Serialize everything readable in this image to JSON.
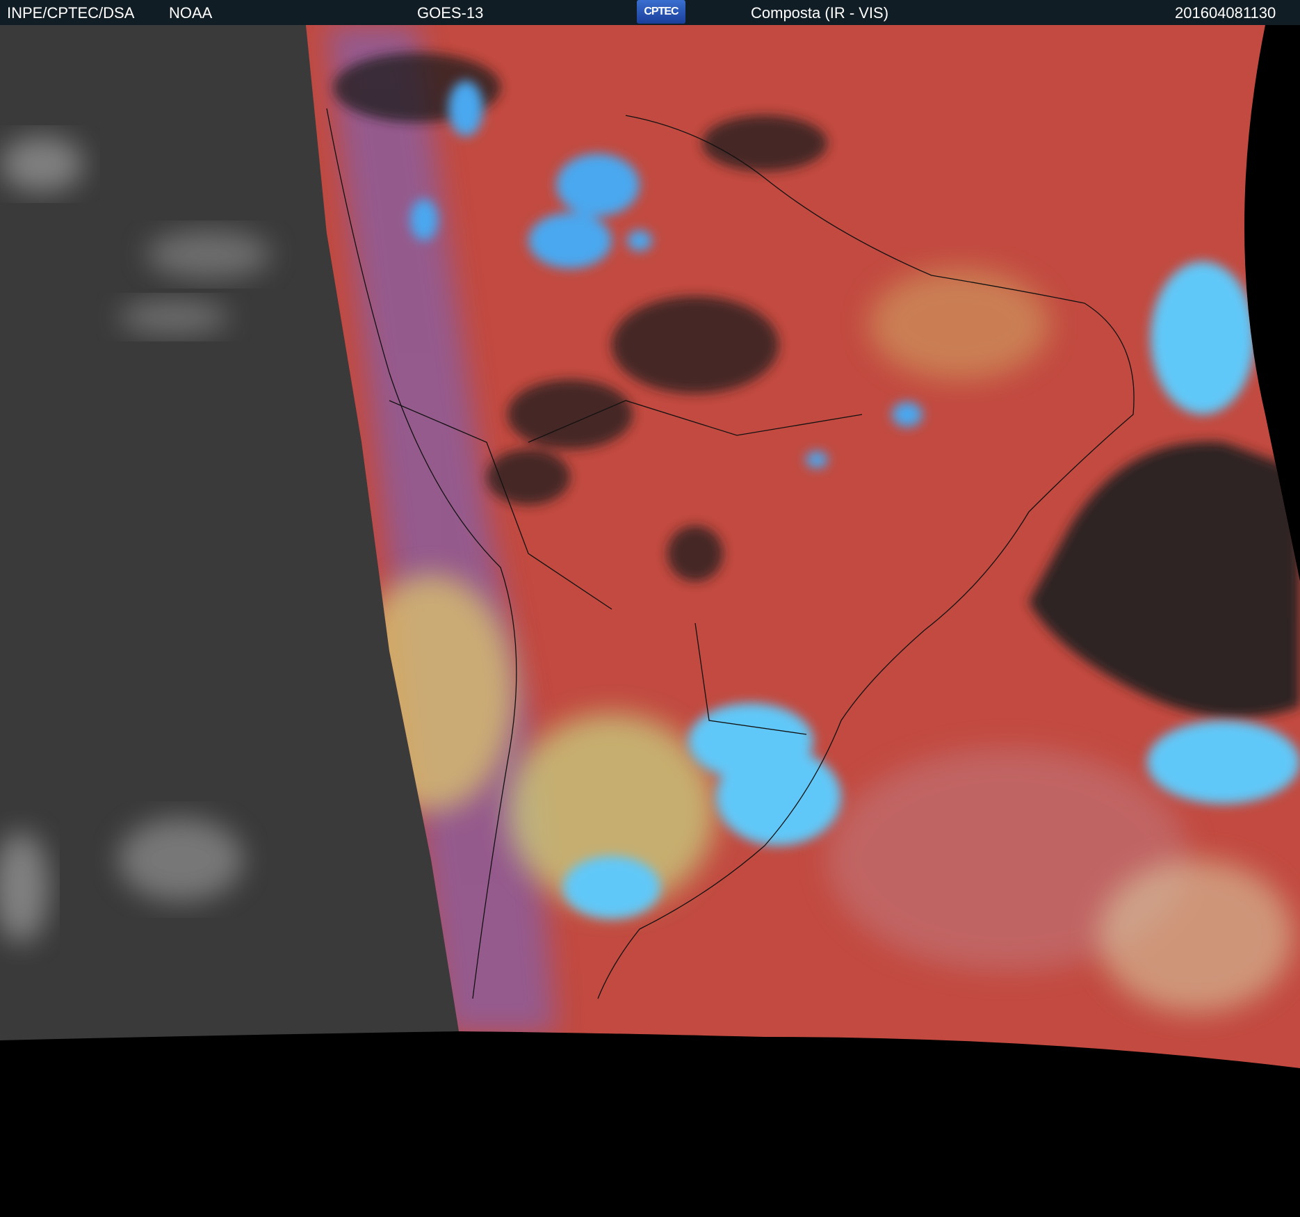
{
  "header": {
    "agency": "INPE/CPTEC/DSA",
    "partner": "NOAA",
    "satellite": "GOES-13",
    "logo_text": "CPTEC",
    "product": "Composta (IR - VIS)",
    "timestamp": "201604081130"
  },
  "colors": {
    "header_bg": "#111d24",
    "ocean_night": "#333333",
    "land_day": "#c24a40",
    "high_cloud": "#4aa8f0",
    "low_cloud": "#d8c070",
    "clear_ground": "#1c1c1c",
    "no_data": "#000000"
  }
}
